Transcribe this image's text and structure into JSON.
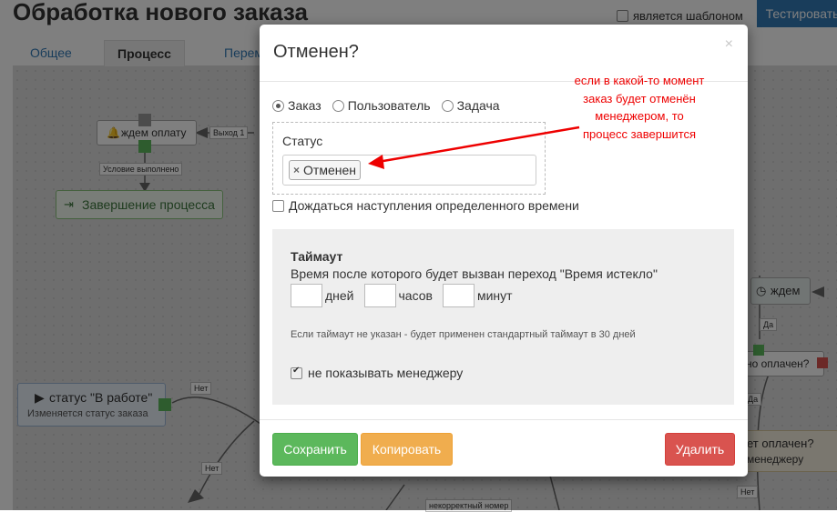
{
  "page": {
    "title": "Обработка нового заказа",
    "template_label": "является шаблоном",
    "test_button": "Тестировать",
    "tabs": [
      {
        "label": "Общее"
      },
      {
        "label": "Процесс"
      },
      {
        "label": "Перем"
      }
    ]
  },
  "canvas": {
    "nodes": {
      "wait_payment": "ждем оплату",
      "finish": "Завершение процесса",
      "status_in_work": "статус \"В работе\"",
      "status_in_work_sub": "Изменяется статус заказа",
      "wait": "ждем",
      "paid_q": "но оплачен?",
      "not_paid_q": "ет оплачен?",
      "manager": "менеджеру"
    },
    "edge_labels": {
      "exit1": "Выход 1",
      "cond_ok": "Условие выполнено",
      "no1": "Нет",
      "no2": "Нет",
      "no3": "Нет",
      "yes1": "Да",
      "yes2": "Да",
      "bad_number": "некорректный номер"
    }
  },
  "modal": {
    "title": "Отменен?",
    "close": "×",
    "radios": [
      {
        "label": "Заказ",
        "checked": true
      },
      {
        "label": "Пользователь",
        "checked": false
      },
      {
        "label": "Задача",
        "checked": false
      }
    ],
    "status_label": "Статус",
    "status_tag": "Отменен",
    "status_tag_remove": "×",
    "wait_time_label": "Дождаться наступления определенного времени",
    "timeout": {
      "title": "Таймаут",
      "description": "Время после которого будет вызван переход \"Время истекло\"",
      "days": "дней",
      "hours": "часов",
      "minutes": "минут",
      "hint": "Если таймаут не указан - будет применен стандартный таймаут в 30 дней",
      "hide_label": "не показывать менеджеру"
    },
    "buttons": {
      "save": "Сохранить",
      "copy": "Копировать",
      "delete": "Удалить"
    }
  },
  "annotation": {
    "lines": [
      "если в какой-то момент",
      "заказ будет отменён",
      "менеджером, то",
      "процесс завершится"
    ],
    "color": "#e00000"
  }
}
